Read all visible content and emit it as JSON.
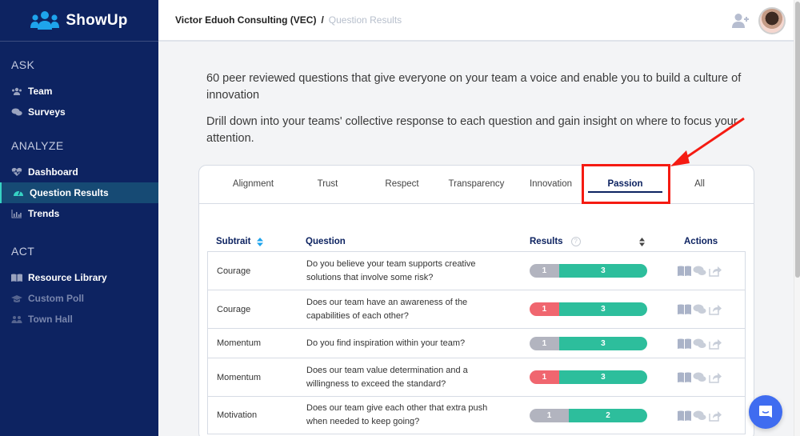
{
  "app": {
    "name": "ShowUp",
    "logo_icon": "team-users-icon",
    "brand_color": "#0d2361",
    "accent_color": "#2dbe9c"
  },
  "sidebar": {
    "sections": [
      {
        "title": "ASK",
        "items": [
          {
            "label": "Team",
            "icon": "users-icon",
            "state": "normal"
          },
          {
            "label": "Surveys",
            "icon": "comments-icon",
            "state": "normal"
          }
        ]
      },
      {
        "title": "ANALYZE",
        "items": [
          {
            "label": "Dashboard",
            "icon": "heartbeat-icon",
            "state": "normal"
          },
          {
            "label": "Question Results",
            "icon": "gauge-icon",
            "state": "active"
          },
          {
            "label": "Trends",
            "icon": "bar-chart-icon",
            "state": "normal"
          }
        ]
      },
      {
        "title": "ACT",
        "items": [
          {
            "label": "Resource Library",
            "icon": "book-icon",
            "state": "normal"
          },
          {
            "label": "Custom Poll",
            "icon": "graduation-cap-icon",
            "state": "disabled"
          },
          {
            "label": "Town Hall",
            "icon": "group-icon",
            "state": "disabled"
          }
        ]
      }
    ]
  },
  "header": {
    "breadcrumb": {
      "root": "Victor Eduoh Consulting (VEC)",
      "separator": "/",
      "current": "Question Results"
    },
    "add_user_icon": "add-user-icon",
    "avatar_alt": "User avatar"
  },
  "intro": {
    "line1": "60 peer reviewed questions that give everyone on your team a voice and enable you to build a culture of innovation",
    "line2": "Drill down into your teams' collective response to each question and gain insight on where to focus your attention."
  },
  "tabs": [
    {
      "label": "Alignment",
      "active": false
    },
    {
      "label": "Trust",
      "active": false
    },
    {
      "label": "Respect",
      "active": false
    },
    {
      "label": "Transparency",
      "active": false
    },
    {
      "label": "Innovation",
      "active": false
    },
    {
      "label": "Passion",
      "active": true
    },
    {
      "label": "All",
      "active": false
    }
  ],
  "table": {
    "columns": {
      "subtrait": "Subtrait",
      "question": "Question",
      "results": "Results",
      "help": "?",
      "actions": "Actions"
    },
    "rows": [
      {
        "subtrait": "Courage",
        "question": "Do you believe your team supports creative solutions that involve some risk?",
        "negative": 1,
        "positive": 3,
        "negative_color": "#b2b4bf"
      },
      {
        "subtrait": "Courage",
        "question": "Does our team have an awareness of the capabilities of each other?",
        "negative": 1,
        "positive": 3,
        "negative_color": "#f0666f"
      },
      {
        "subtrait": "Momentum",
        "question": "Do you find inspiration within your team?",
        "negative": 1,
        "positive": 3,
        "negative_color": "#b2b4bf"
      },
      {
        "subtrait": "Momentum",
        "question": "Does our team value determination and a willingness to exceed the standard?",
        "negative": 1,
        "positive": 3,
        "negative_color": "#f0666f"
      },
      {
        "subtrait": "Motivation",
        "question": "Does our team give each other that extra push when needed to keep going?",
        "negative": 1,
        "positive": 2,
        "negative_color": "#b2b4bf"
      }
    ],
    "row_actions": [
      "book-icon",
      "comments-icon",
      "share-icon"
    ]
  },
  "annotation": {
    "color": "#f51b12",
    "target": "Passion tab"
  },
  "chat_launcher": {
    "icon": "chat-icon",
    "color": "#3f6cf0"
  }
}
